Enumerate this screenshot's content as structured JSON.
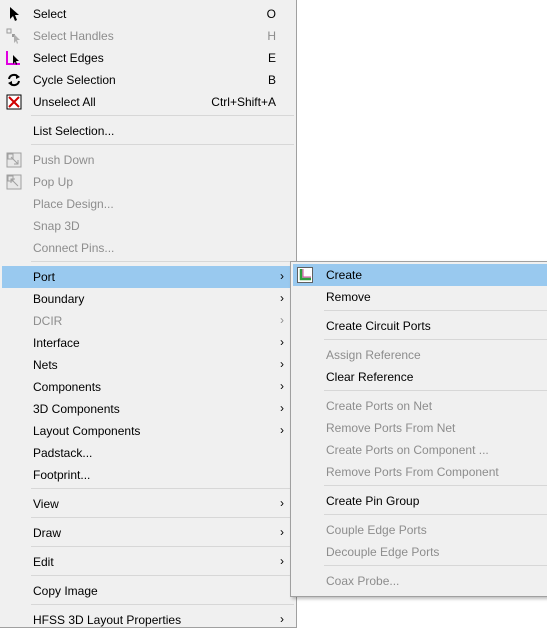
{
  "main_menu": {
    "items": [
      {
        "label": "Select",
        "shortcut": "O"
      },
      {
        "label": "Select Handles",
        "shortcut": "H"
      },
      {
        "label": "Select Edges",
        "shortcut": "E"
      },
      {
        "label": "Cycle Selection",
        "shortcut": "B"
      },
      {
        "label": "Unselect All",
        "shortcut": "Ctrl+Shift+A"
      },
      {
        "label": "List Selection..."
      },
      {
        "label": "Push Down"
      },
      {
        "label": "Pop Up"
      },
      {
        "label": "Place Design..."
      },
      {
        "label": "Snap 3D"
      },
      {
        "label": "Connect Pins..."
      },
      {
        "label": "Port"
      },
      {
        "label": "Boundary"
      },
      {
        "label": "DCIR"
      },
      {
        "label": "Interface"
      },
      {
        "label": "Nets"
      },
      {
        "label": "Components"
      },
      {
        "label": "3D Components"
      },
      {
        "label": "Layout Components"
      },
      {
        "label": "Padstack..."
      },
      {
        "label": "Footprint..."
      },
      {
        "label": "View"
      },
      {
        "label": "Draw"
      },
      {
        "label": "Edit"
      },
      {
        "label": "Copy Image"
      },
      {
        "label": "HFSS 3D Layout Properties"
      }
    ],
    "submenu_arrow": "›"
  },
  "port_submenu": {
    "items": [
      {
        "label": "Create"
      },
      {
        "label": "Remove"
      },
      {
        "label": "Create Circuit Ports"
      },
      {
        "label": "Assign Reference"
      },
      {
        "label": "Clear Reference"
      },
      {
        "label": "Create Ports on Net"
      },
      {
        "label": "Remove Ports From Net"
      },
      {
        "label": "Create Ports on Component ..."
      },
      {
        "label": "Remove Ports From Component"
      },
      {
        "label": "Create Pin Group"
      },
      {
        "label": "Couple Edge Ports"
      },
      {
        "label": "Decouple Edge Ports"
      },
      {
        "label": "Coax Probe..."
      }
    ]
  },
  "icons": {
    "select": "cursor-arrow-icon",
    "select_handles": "select-handles-icon",
    "select_edges": "select-edges-icon",
    "cycle_selection": "cycle-arrows-icon",
    "unselect_all": "unselect-all-icon",
    "push_down": "push-down-icon",
    "pop_up": "pop-up-icon",
    "port_create": "create-port-icon"
  },
  "colors": {
    "menu_bg": "#f0f0f0",
    "highlight": "#99c9ef",
    "disabled_text": "#8d8d8d",
    "separator": "#d7d7d7"
  }
}
